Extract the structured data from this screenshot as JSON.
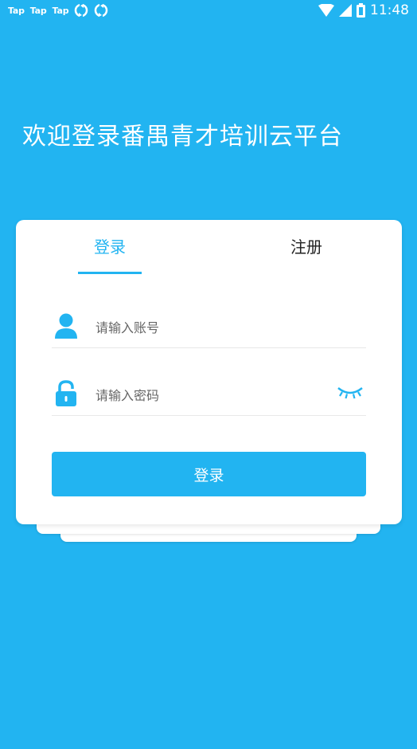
{
  "status_bar": {
    "notifications": [
      "Tap",
      "Tap",
      "Tap"
    ],
    "time": "11:48",
    "icons": [
      "sync-icon",
      "sync-icon",
      "wifi-icon",
      "signal-icon",
      "battery-icon"
    ]
  },
  "headline": "欢迎登录番禺青才培训云平台",
  "tabs": {
    "login": "登录",
    "register": "注册"
  },
  "form": {
    "account_placeholder": "请输入账号",
    "password_placeholder": "请输入密码",
    "submit_label": "登录"
  },
  "colors": {
    "background": "#22b4f1",
    "accent": "#22b4f1",
    "card": "#ffffff"
  }
}
